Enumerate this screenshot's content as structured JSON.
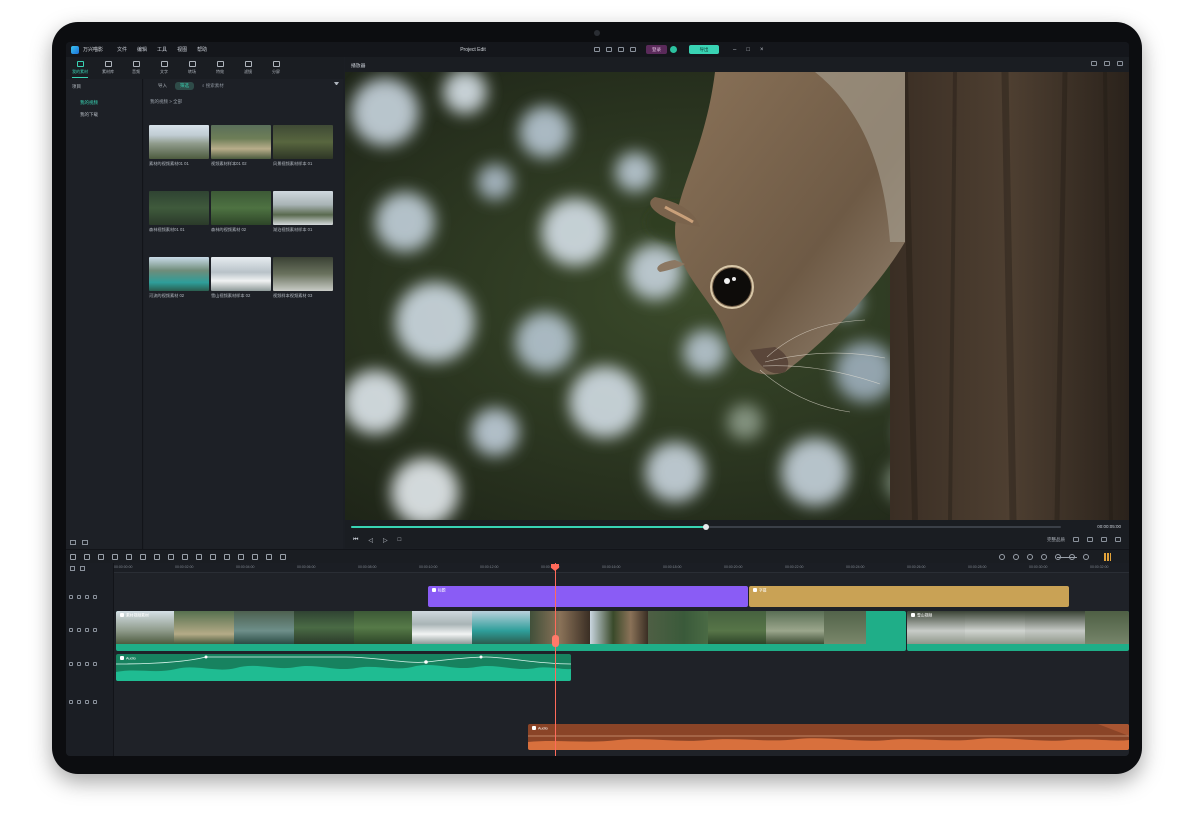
{
  "app": {
    "name": "万兴喵影",
    "menu": [
      "文件",
      "编辑",
      "工具",
      "视图",
      "帮助"
    ],
    "project_title": "Project Edit",
    "login_label": "登录",
    "export_label": "导出"
  },
  "toolbar": {
    "tools": [
      {
        "label": "我的素材",
        "icon": "media-icon",
        "active": true
      },
      {
        "label": "素材库",
        "icon": "stock-icon",
        "active": false
      },
      {
        "label": "音频",
        "icon": "music-icon",
        "active": false
      },
      {
        "label": "文字",
        "icon": "text-icon",
        "active": false
      },
      {
        "label": "转场",
        "icon": "transition-icon",
        "active": false
      },
      {
        "label": "特效",
        "icon": "effect-icon",
        "active": false
      },
      {
        "label": "滤镜",
        "icon": "filter-icon",
        "active": false
      },
      {
        "label": "分屏",
        "icon": "split-screen-icon",
        "active": false
      }
    ]
  },
  "sidebar": {
    "section": "项目",
    "items": [
      {
        "label": "我的视频",
        "active": true
      },
      {
        "label": "我的下载",
        "active": false
      }
    ]
  },
  "media": {
    "tabs": [
      "导入",
      "筛选"
    ],
    "active_tab": "筛选",
    "search_placeholder": "搜索素材",
    "breadcrumb": "我的视频 > 全部",
    "items": [
      {
        "label": "素材的视频素材01 01"
      },
      {
        "label": "视频素材样本01 02"
      },
      {
        "label": "风景视频素材样本 01"
      },
      {
        "label": "森林视频素材01 01"
      },
      {
        "label": "森林的视频素材 02"
      },
      {
        "label": "湖泊视频素材样本 01"
      },
      {
        "label": "河流的视频素材 02"
      },
      {
        "label": "雪山视频素材样本 02"
      },
      {
        "label": "视频样本视频素材 03"
      }
    ]
  },
  "preview": {
    "title": "播放器",
    "timecode": "00:00:05:00",
    "progress": 0.5,
    "quality_label": "完整品质"
  },
  "timeline": {
    "ruler": [
      "00:00:00:00",
      "00:00:02:00",
      "00:00:04:00",
      "00:00:06:00",
      "00:00:08:00",
      "00:00:10:00",
      "00:00:12:00",
      "00:00:14:00",
      "00:00:16:00",
      "00:00:18:00",
      "00:00:20:00",
      "00:00:22:00",
      "00:00:24:00",
      "00:00:26:00",
      "00:00:28:00",
      "00:00:30:00",
      "00:00:32:00"
    ],
    "clips": {
      "title_purple": "标题",
      "title_gold": "字幕",
      "video_main": "素材视频素材",
      "video_second": "雪山视频",
      "audio_green": "Audio",
      "audio_orange": "Audio"
    }
  },
  "colors": {
    "accent": "#39d3b4",
    "purple_clip": "#8a5cf5",
    "gold_clip": "#c9a255",
    "audio_green": "#1fae88",
    "audio_orange": "#d8703d",
    "playhead": "#ff6a5a"
  }
}
